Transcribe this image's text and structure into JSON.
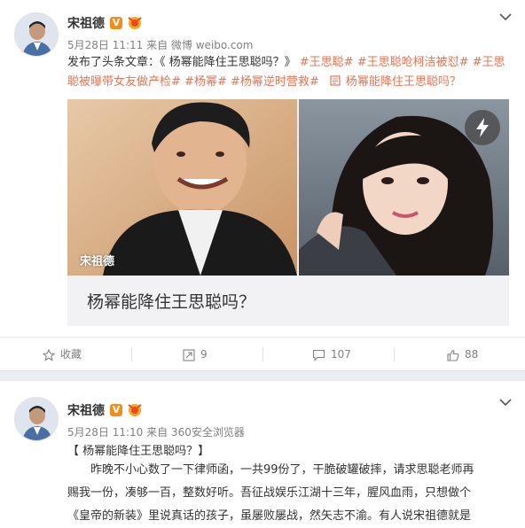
{
  "post1": {
    "author": "宋祖德",
    "verified_badge": "V",
    "meta": "5月28日 11:11 来自 微博 weibo.com",
    "text_prefix": "发布了头条文章：《 杨幂能降住王思聪吗？》 ",
    "tags": [
      "#王思聪#",
      "#王思聪呛柯洁被怼#",
      "#王思聪被曝带女友做产检#",
      "#杨幂#",
      "#杨幂逆时营救#"
    ],
    "link_icon": "article-icon",
    "link_text": "杨幂能降住王思聪吗？",
    "card": {
      "title": "杨幂能降住王思聪吗？",
      "watermark": "宋祖德"
    },
    "actions": {
      "favorite": "收藏",
      "repost": "9",
      "comment": "107",
      "like": "88"
    }
  },
  "post2": {
    "author": "宋祖德",
    "verified_badge": "V",
    "meta": "5月28日 11:10 来自 360安全浏览器",
    "article_title": "【 杨幂能降住王思聪吗？】",
    "body_lines": [
      "昨晚不小心数了一下律师函，一共99份了，干脆破罐破摔，请求思聪老师再",
      "赐我一份，凑够一百，整数好听。吾征战娱乐江湖十三年，腥风血雨，只想做个",
      "《皇帝的新装》里说真话的孩子，虽屡败屡战，然矢志不渝。有人说宋祖德就是"
    ]
  },
  "colors": {
    "accent": "#eb7350",
    "badge": "#f08e1c",
    "meta": "#808080"
  }
}
